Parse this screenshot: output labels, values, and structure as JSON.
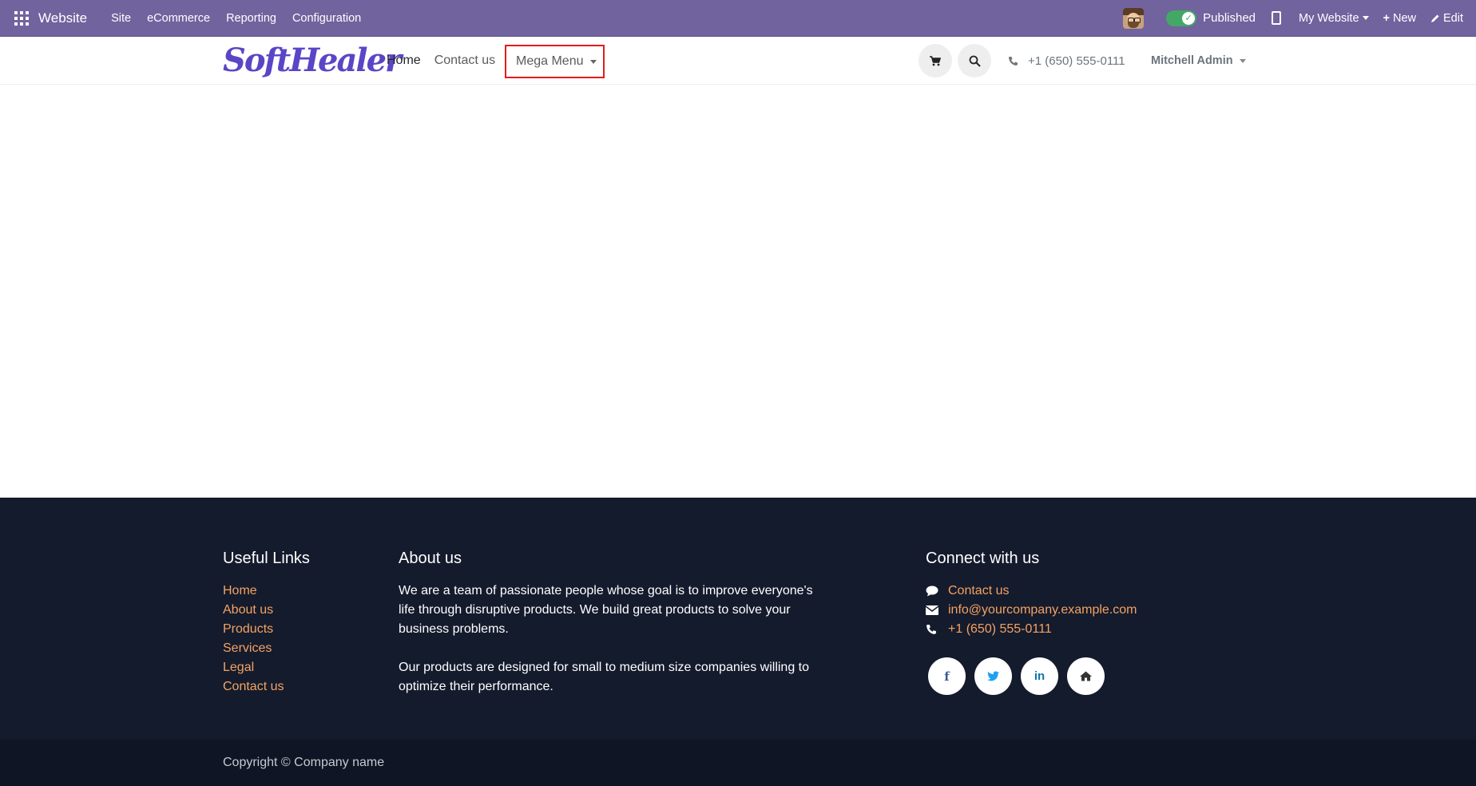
{
  "topbar": {
    "brand": "Website",
    "menu": [
      "Site",
      "eCommerce",
      "Reporting",
      "Configuration"
    ],
    "published_label": "Published",
    "website_label": "My Website",
    "new_label": "New",
    "edit_label": "Edit"
  },
  "header": {
    "logo_text": "SoftHealer",
    "nav": {
      "home": "Home",
      "contact": "Contact us",
      "mega": "Mega Menu"
    },
    "phone": "+1 (650) 555-0111",
    "user": "Mitchell Admin"
  },
  "footer": {
    "useful_links": {
      "title": "Useful Links",
      "items": [
        "Home",
        "About us",
        "Products",
        "Services",
        "Legal",
        "Contact us"
      ]
    },
    "about": {
      "title": "About us",
      "p1": "We are a team of passionate people whose goal is to improve everyone's life through disruptive products. We build great products to solve your business problems.",
      "p2": "Our products are designed for small to medium size companies willing to optimize their performance."
    },
    "connect": {
      "title": "Connect with us",
      "contact": "Contact us",
      "email": "info@yourcompany.example.com",
      "phone": "+1 (650) 555-0111",
      "socials": [
        "facebook-icon",
        "twitter-icon",
        "linkedin-icon",
        "home-icon"
      ]
    },
    "copyright": "Copyright © Company name"
  },
  "colors": {
    "topbar": "#71639e",
    "footer": "#141b2d",
    "link": "#f4a261",
    "highlight": "#e31c1c"
  }
}
